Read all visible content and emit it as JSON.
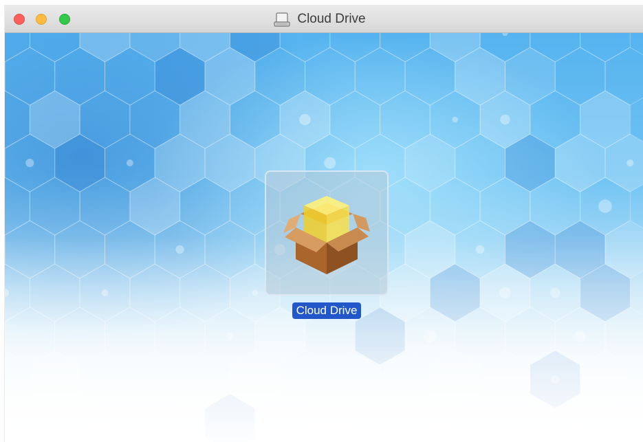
{
  "window": {
    "title": "Cloud Drive",
    "title_icon": "disk-image-icon",
    "traffic_lights": {
      "close_color": "#fc605b",
      "minimize_color": "#fdbc40",
      "zoom_color": "#34c84a"
    }
  },
  "content": {
    "background": "blue hexagon pattern fading to white",
    "items": [
      {
        "label": "Cloud Drive",
        "icon": "package-installer-icon",
        "selected": true
      }
    ]
  },
  "colors": {
    "selection": "#2257c9",
    "background_blue": "#4aa8e8"
  }
}
